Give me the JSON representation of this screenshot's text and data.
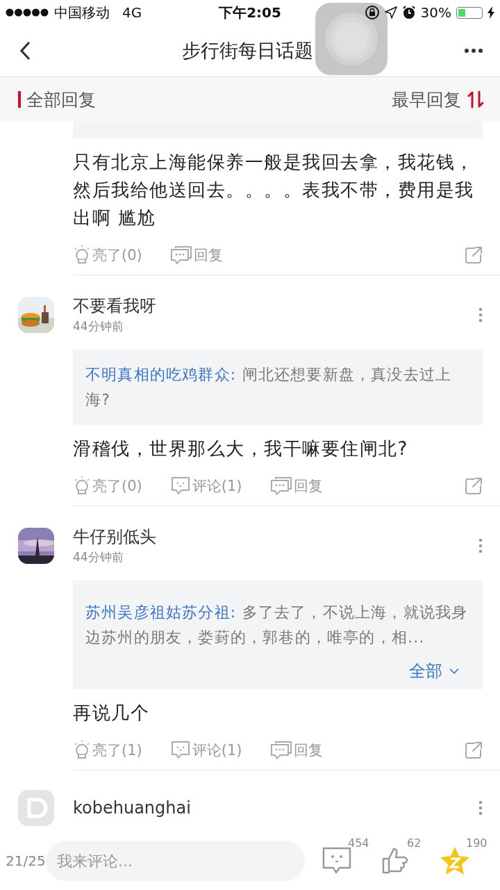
{
  "status_bar": {
    "carrier": "中国移动",
    "network": "4G",
    "time": "下午2:05",
    "battery": "30%"
  },
  "nav": {
    "title": "步行街每日话题"
  },
  "filter": {
    "left": "全部回复",
    "right": "最早回复"
  },
  "comments": [
    {
      "quote": {
        "kind": "cut"
      },
      "body": "只有北京上海能保养一般是我回去拿，我花钱，然后我给他送回去。。。。表我不带，费用是我出啊 尴尬",
      "actions": [
        {
          "kind": "light",
          "label": "亮了(0)"
        },
        {
          "kind": "reply",
          "label": "回复"
        }
      ]
    },
    {
      "author": "不要看我呀",
      "time": "44分钟前",
      "avatar": {
        "kind": "picture"
      },
      "quote": {
        "kind": "full",
        "author": "不明真相的吃鸡群众:",
        "text": "闸北还想要新盘，真没去过上海?"
      },
      "body": "滑稽伐，世界那么大，我干嘛要住闸北?",
      "actions": [
        {
          "kind": "light",
          "label": "亮了(0)"
        },
        {
          "kind": "comment",
          "label": "评论(1)"
        },
        {
          "kind": "reply",
          "label": "回复"
        }
      ]
    },
    {
      "author": "牛仔别低头",
      "time": "44分钟前",
      "avatar": {
        "kind": "picture"
      },
      "quote": {
        "kind": "full",
        "author": "苏州吴彦祖姑苏分祖:",
        "text": "多了去了，不说上海，就说我身边苏州的朋友，娄葑的，郭巷的，唯亭的，相...",
        "more": "全部"
      },
      "body": "再说几个",
      "actions": [
        {
          "kind": "light",
          "label": "亮了(1)"
        },
        {
          "kind": "comment",
          "label": "评论(1)"
        },
        {
          "kind": "reply",
          "label": "回复"
        }
      ]
    },
    {
      "author": "kobehuanghai",
      "avatar": {
        "kind": "default"
      }
    }
  ],
  "bottom": {
    "page": "21/25",
    "placeholder": "我来评论...",
    "counts": [
      {
        "kind": "comment",
        "count": "454"
      },
      {
        "kind": "like",
        "count": "62"
      },
      {
        "kind": "favorite",
        "count": "190"
      }
    ]
  }
}
